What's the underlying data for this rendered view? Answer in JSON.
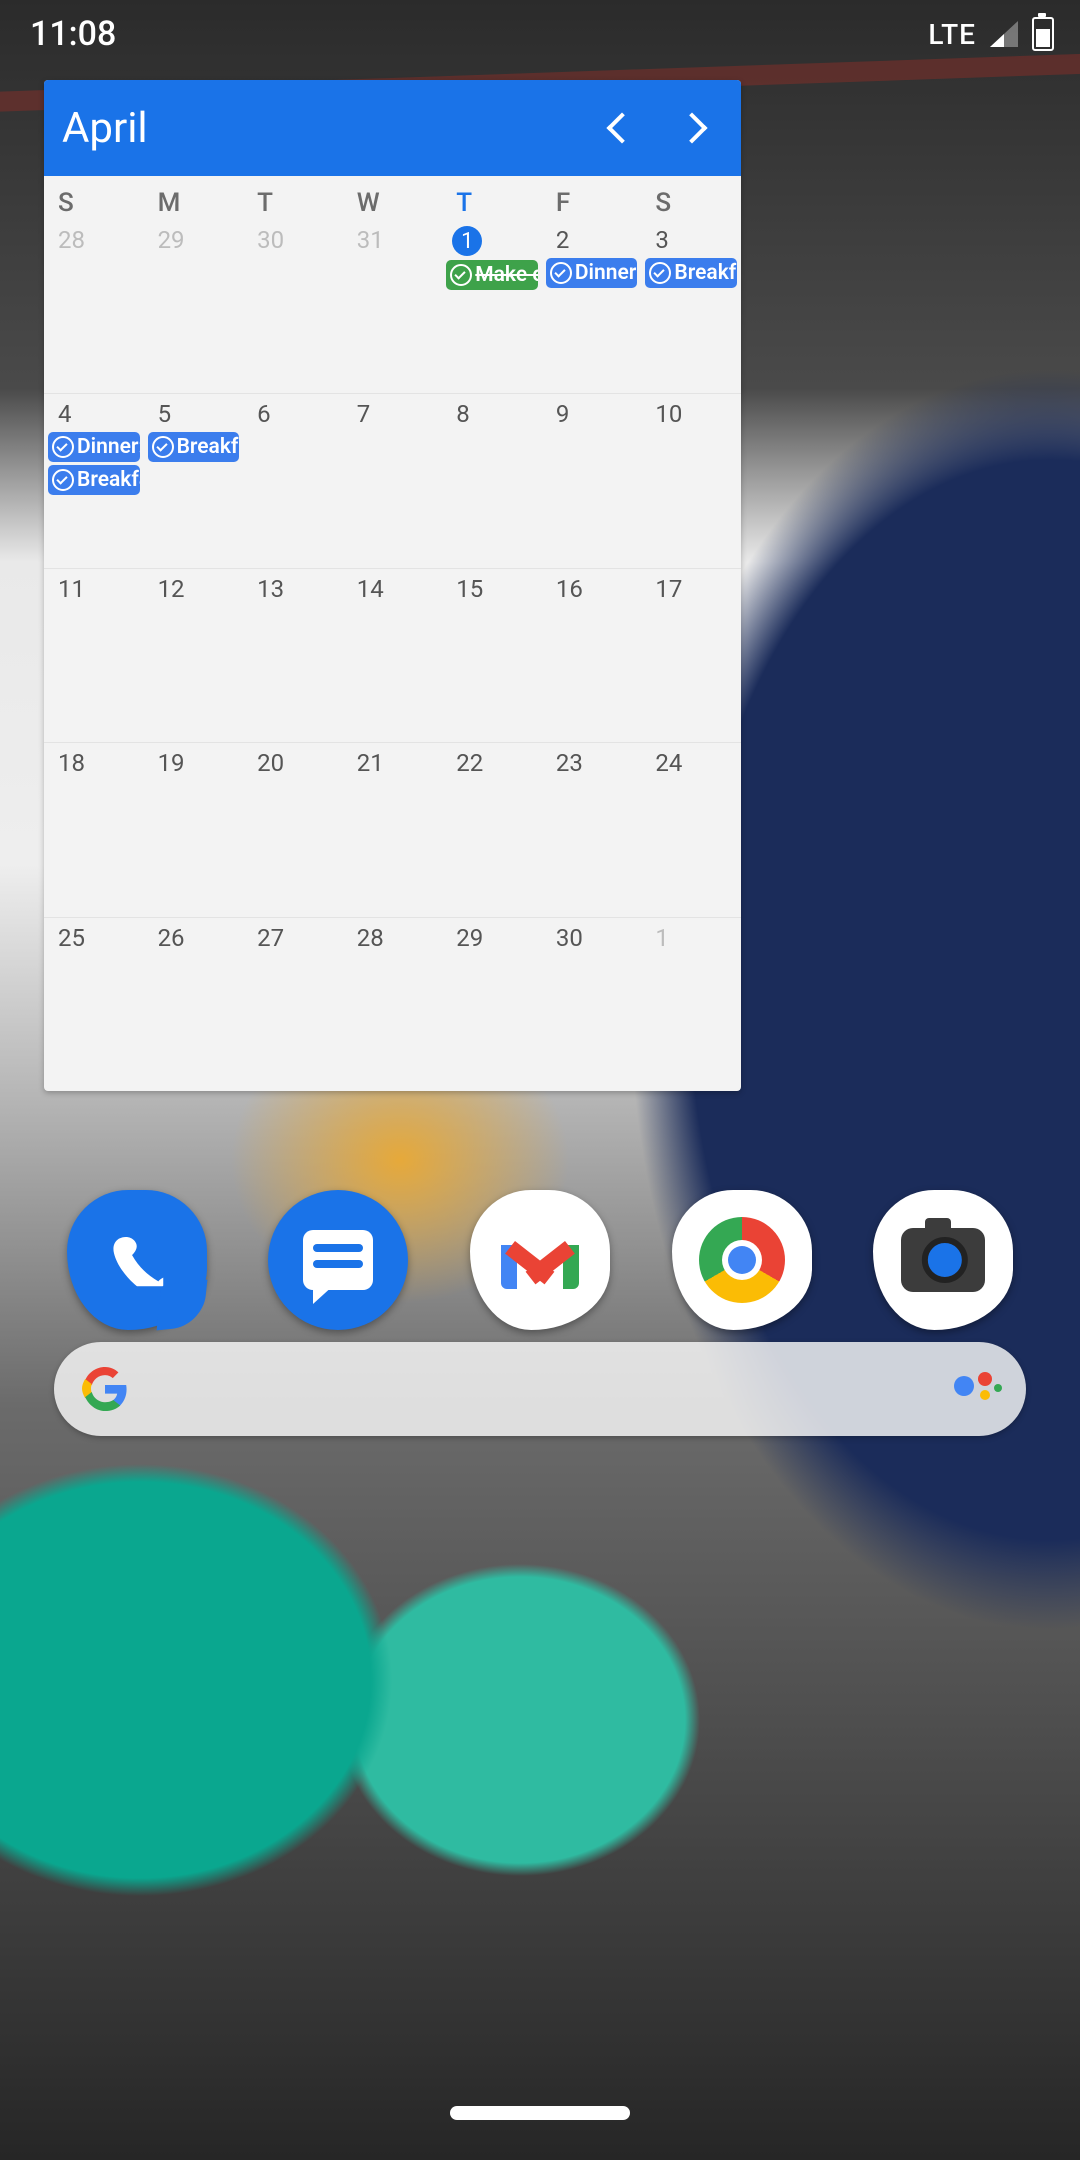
{
  "status": {
    "time": "11:08",
    "network": "LTE"
  },
  "calendar": {
    "month_label": "April",
    "today_index": 4,
    "days_of_week": [
      "S",
      "M",
      "T",
      "W",
      "T",
      "F",
      "S"
    ],
    "weeks": [
      [
        {
          "n": "28",
          "other": true,
          "events": []
        },
        {
          "n": "29",
          "other": true,
          "events": []
        },
        {
          "n": "30",
          "other": true,
          "events": []
        },
        {
          "n": "31",
          "other": true,
          "events": []
        },
        {
          "n": "1",
          "today": true,
          "events": [
            {
              "label": "Make c",
              "done": true
            }
          ]
        },
        {
          "n": "2",
          "events": [
            {
              "label": "Dinner:"
            }
          ]
        },
        {
          "n": "3",
          "events": [
            {
              "label": "Breakfa"
            }
          ]
        }
      ],
      [
        {
          "n": "4",
          "events": [
            {
              "label": "Dinner:"
            },
            {
              "label": "Breakfa"
            }
          ]
        },
        {
          "n": "5",
          "events": [
            {
              "label": "Breakfa"
            }
          ]
        },
        {
          "n": "6",
          "events": []
        },
        {
          "n": "7",
          "events": []
        },
        {
          "n": "8",
          "events": []
        },
        {
          "n": "9",
          "events": []
        },
        {
          "n": "10",
          "events": []
        }
      ],
      [
        {
          "n": "11",
          "events": []
        },
        {
          "n": "12",
          "events": []
        },
        {
          "n": "13",
          "events": []
        },
        {
          "n": "14",
          "events": []
        },
        {
          "n": "15",
          "events": []
        },
        {
          "n": "16",
          "events": []
        },
        {
          "n": "17",
          "events": []
        }
      ],
      [
        {
          "n": "18",
          "events": []
        },
        {
          "n": "19",
          "events": []
        },
        {
          "n": "20",
          "events": []
        },
        {
          "n": "21",
          "events": []
        },
        {
          "n": "22",
          "events": []
        },
        {
          "n": "23",
          "events": []
        },
        {
          "n": "24",
          "events": []
        }
      ],
      [
        {
          "n": "25",
          "events": []
        },
        {
          "n": "26",
          "events": []
        },
        {
          "n": "27",
          "events": []
        },
        {
          "n": "28",
          "events": []
        },
        {
          "n": "29",
          "events": []
        },
        {
          "n": "30",
          "events": []
        },
        {
          "n": "1",
          "other": true,
          "events": []
        }
      ]
    ]
  },
  "dock": {
    "apps": [
      "phone",
      "messages",
      "gmail",
      "chrome",
      "camera"
    ]
  }
}
